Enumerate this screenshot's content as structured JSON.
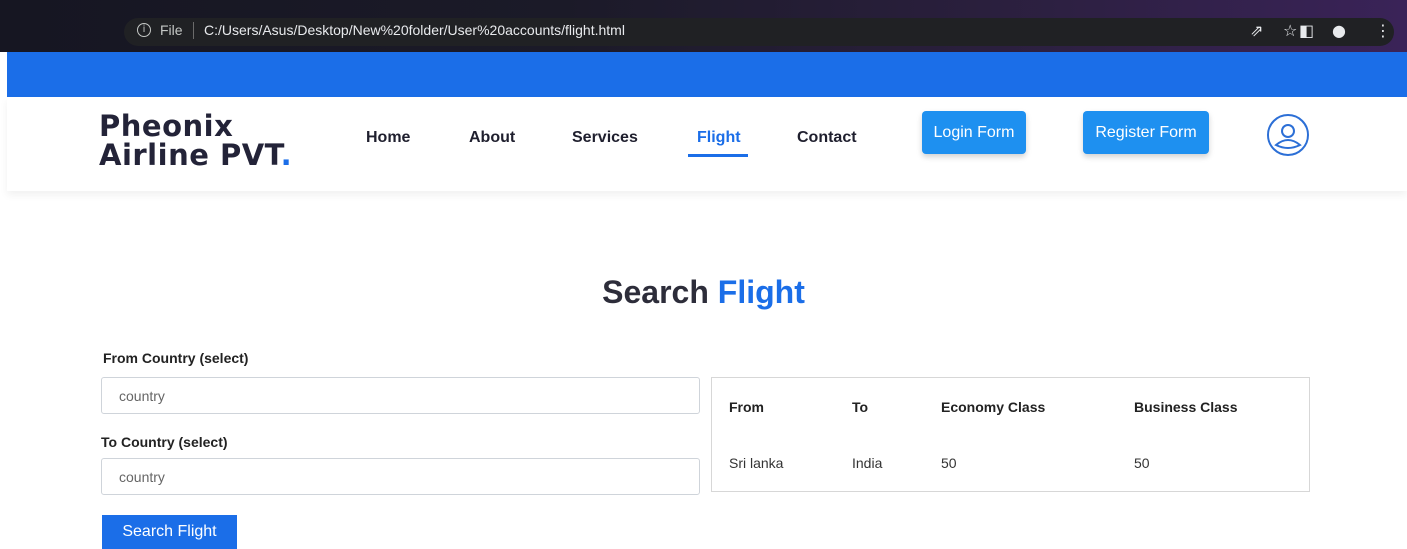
{
  "browser": {
    "back_icon": "←",
    "forward_icon": "→",
    "reload_icon": "C",
    "info_icon": "i",
    "file_label": "File",
    "url": "C:/Users/Asus/Desktop/New%20folder/User%20accounts/flight.html",
    "share_icon": "⇗",
    "star_icon": "☆",
    "sidepanel_icon": "◧",
    "profile_icon": "●",
    "menu_icon": "⋮"
  },
  "header": {
    "logo_line1": "Pheonix",
    "logo_line2": "Airline PVT",
    "logo_dot": ".",
    "nav": [
      "Home",
      "About",
      "Services",
      "Flight",
      "Contact"
    ],
    "login_label": "Login Form",
    "register_label": "Register Form",
    "accent": "#1b6ee8"
  },
  "search": {
    "title_dark": "Search",
    "title_blue": "Flight",
    "from_label": "From Country (select)",
    "from_placeholder": "country",
    "to_label": "To Country (select)",
    "to_placeholder": "country",
    "button_label": "Search Flight"
  },
  "results": {
    "columns": [
      "From",
      "To",
      "Economy Class",
      "Business Class"
    ],
    "rows": [
      [
        "Sri lanka",
        "India",
        "50",
        "50"
      ]
    ]
  }
}
